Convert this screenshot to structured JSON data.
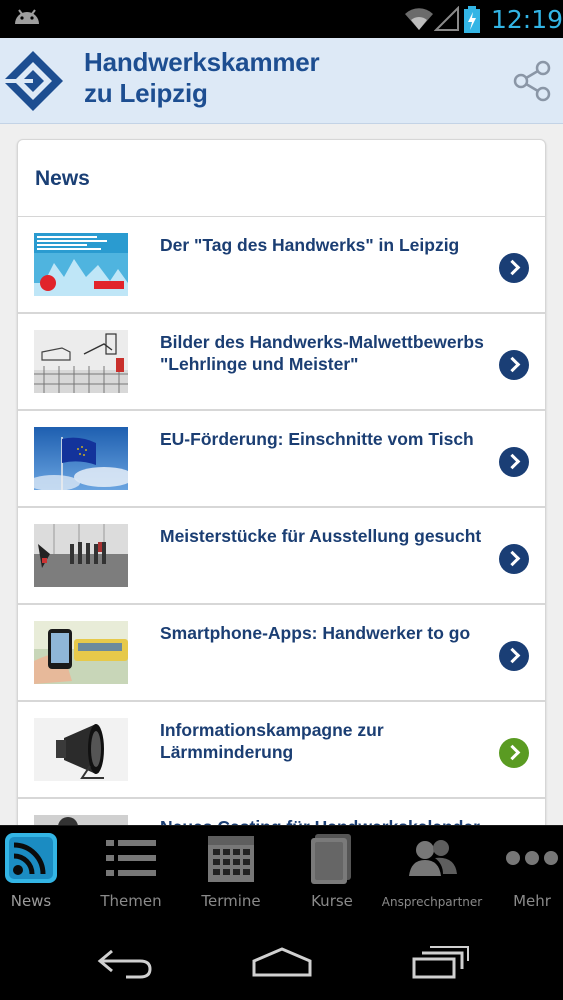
{
  "status_bar": {
    "time": "12:19",
    "accent": "#33b5e5",
    "icons": [
      "android-icon",
      "wifi-icon",
      "signal-icon",
      "battery-charging-icon"
    ]
  },
  "header": {
    "title_line1": "Handwerkskammer",
    "title_line2": "zu Leipzig",
    "brand_color": "#1d4e91",
    "share_icon": "share-icon"
  },
  "card": {
    "title": "News",
    "items": [
      {
        "title": "Der \"Tag des Handwerks\" in Leipzig",
        "chevron": "chevron-right-icon",
        "chevron_color": "#1a3e75"
      },
      {
        "title": "Bilder des Handwerks-Malwettbewerbs \"Lehrlinge und Meister\"",
        "chevron": "chevron-right-icon",
        "chevron_color": "#1a3e75"
      },
      {
        "title": "EU-Förderung: Einschnitte vom Tisch",
        "chevron": "chevron-right-icon",
        "chevron_color": "#1a3e75"
      },
      {
        "title": "Meisterstücke für Ausstellung gesucht",
        "chevron": "chevron-right-icon",
        "chevron_color": "#1a3e75"
      },
      {
        "title": "Smartphone-Apps: Handwerker to go",
        "chevron": "chevron-right-icon",
        "chevron_color": "#1a3e75"
      },
      {
        "title": "Informationskampagne zur Lärmminderung",
        "chevron": "chevron-right-icon",
        "chevron_color": "#5a9b22"
      },
      {
        "title": "Neues Casting für Handwerkskalender",
        "chevron": "chevron-right-icon",
        "chevron_color": "#1a3e75"
      }
    ]
  },
  "tabs": [
    {
      "label": "News",
      "icon": "rss-feed-icon",
      "active": true
    },
    {
      "label": "Themen",
      "icon": "list-icon",
      "active": false
    },
    {
      "label": "Termine",
      "icon": "calendar-icon",
      "active": false
    },
    {
      "label": "Kurse",
      "icon": "book-icon",
      "active": false
    },
    {
      "label": "Ansprechpartner",
      "icon": "contacts-icon",
      "active": false
    },
    {
      "label": "Mehr",
      "icon": "more-icon",
      "active": false
    }
  ],
  "nav": {
    "back": "back-icon",
    "home": "home-icon",
    "recent": "recent-apps-icon"
  }
}
